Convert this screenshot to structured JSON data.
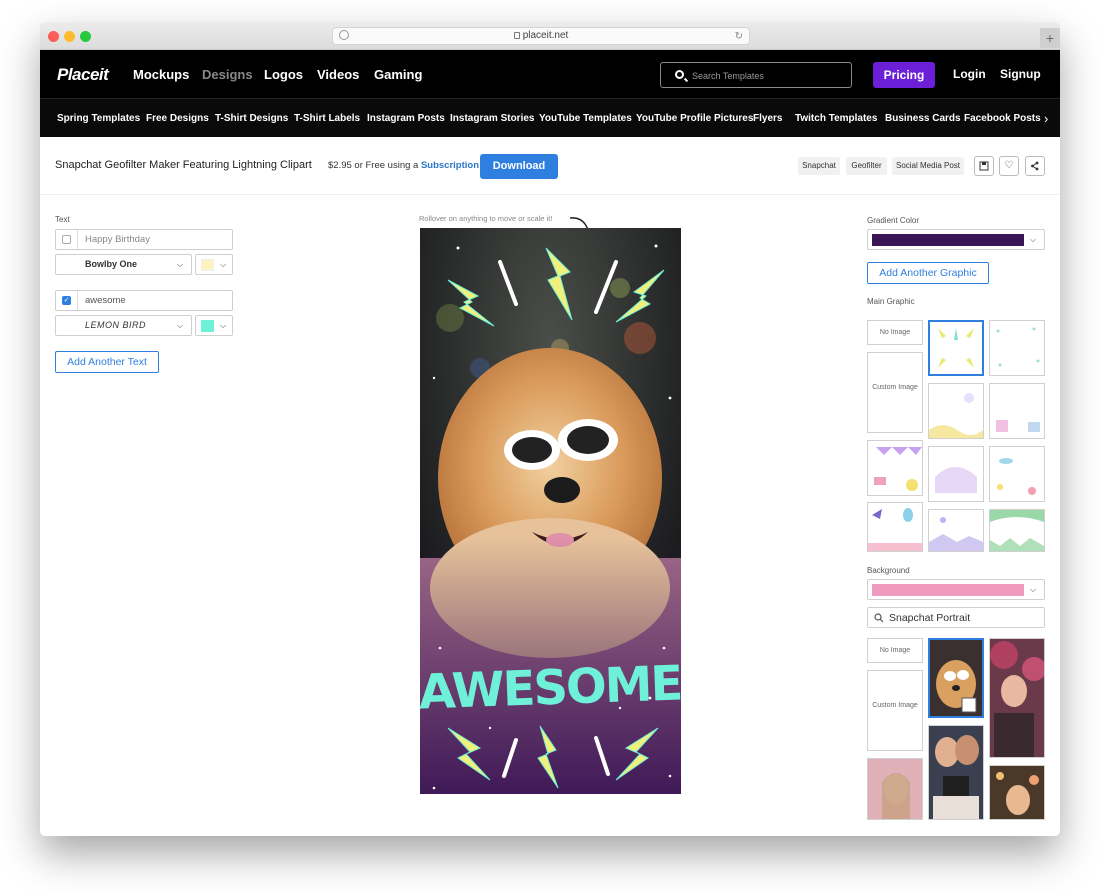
{
  "browser": {
    "url": "placeit.net"
  },
  "nav": {
    "logo": "Placeit",
    "links": [
      "Mockups",
      "Designs",
      "Logos",
      "Videos",
      "Gaming"
    ],
    "search_placeholder": "Search Templates",
    "pricing": "Pricing",
    "login": "Login",
    "signup": "Signup"
  },
  "categories": [
    "Spring Templates",
    "Free Designs",
    "T-Shirt Designs",
    "T-Shirt Labels",
    "Instagram Posts",
    "Instagram Stories",
    "YouTube Templates",
    "YouTube Profile Pictures",
    "Flyers",
    "Twitch Templates",
    "Business Cards",
    "Facebook Posts"
  ],
  "toolbar": {
    "title": "Snapchat Geofilter Maker Featuring Lightning Clipart",
    "price": "$2.95",
    "price_mid": " or Free using a ",
    "subscription": "Subscription",
    "download": "Download",
    "tags": [
      "Snapchat",
      "Geofilter",
      "Social Media Post"
    ]
  },
  "left": {
    "text_label": "Text",
    "text1_placeholder": "Happy Birthday",
    "font1": "Bowlby One",
    "color1": "#fdf3c0",
    "text2_value": "awesome",
    "font2": "LEMON BIRD",
    "color2": "#6ff0d8",
    "add_text": "Add Another Text"
  },
  "canvas": {
    "hint": "Rollover on anything to move or scale it!",
    "headline": "AWESOME",
    "headline_color": "#6ff0d8"
  },
  "right": {
    "gradient_label": "Gradient Color",
    "gradient_color": "#3a1555",
    "add_graphic": "Add Another Graphic",
    "main_graphic_label": "Main Graphic",
    "no_image": "No Image",
    "custom_image": "Custom Image",
    "background_label": "Background",
    "background_color": "#f19ac0",
    "bg_search_value": "Snapchat Portrait"
  }
}
